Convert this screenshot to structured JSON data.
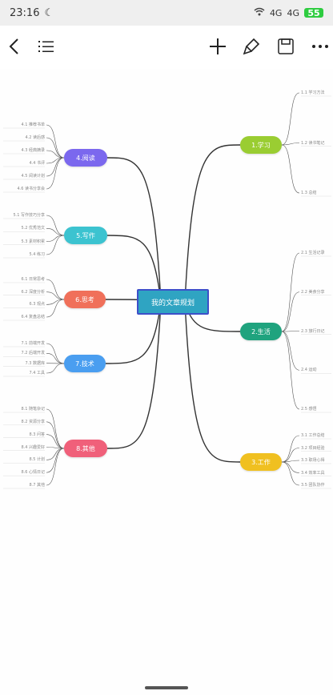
{
  "status_bar": {
    "time": "23:16",
    "signal_1": "4G",
    "signal_2": "4G",
    "battery": "55"
  },
  "toolbar": {
    "back_icon": "chevron-left-icon",
    "outline_icon": "list-icon",
    "add_icon": "plus-icon",
    "style_icon": "brush-icon",
    "save_icon": "save-icon",
    "more_icon": "more-icon"
  },
  "mindmap": {
    "central": {
      "label": "我的文章规划",
      "color": "#2fa4c2",
      "border": "#3d4fc9"
    },
    "branches": [
      {
        "id": "b1",
        "label": "1.学习",
        "color": "#9acd32",
        "leaves": [
          "1.1 学习方法",
          "1.2 读书笔记",
          "1.3 总结"
        ]
      },
      {
        "id": "b2",
        "label": "2.生活",
        "color": "#1fa37e",
        "leaves": [
          "2.1 生活记录",
          "2.2 美食分享",
          "2.3 旅行日记",
          "2.4 运动",
          "2.5 感悟"
        ]
      },
      {
        "id": "b3",
        "label": "3.工作",
        "color": "#f0c020",
        "leaves": [
          "3.1 工作总结",
          "3.2 项目经验",
          "3.3 职场心得",
          "3.4 效率工具",
          "3.5 团队协作"
        ]
      },
      {
        "id": "b4",
        "label": "4.阅读",
        "color": "#7b68ee",
        "leaves": [
          "4.1 推荐书单",
          "4.2 读后感",
          "4.3 经典摘录",
          "4.4 书评",
          "4.5 阅读计划",
          "4.6 读书分享会"
        ]
      },
      {
        "id": "b5",
        "label": "5.写作",
        "color": "#3cc3d0",
        "leaves": [
          "5.1 写作技巧分享",
          "5.2 优秀范文",
          "5.3 素材积累",
          "5.4 练习"
        ]
      },
      {
        "id": "b6",
        "label": "6.思考",
        "color": "#f0705a",
        "leaves": [
          "6.1 日常思考",
          "6.2 深度分析",
          "6.3 观点",
          "6.4 复盘总结"
        ]
      },
      {
        "id": "b7",
        "label": "7.技术",
        "color": "#4a9ef0",
        "leaves": [
          "7.1 前端开发",
          "7.2 后端开发",
          "7.3 数据库",
          "7.4 工具"
        ]
      },
      {
        "id": "b8",
        "label": "8.其他",
        "color": "#f0607a",
        "leaves": [
          "8.1 随笔杂记",
          "8.2 资源分享",
          "8.3 问答",
          "8.4 兴趣爱好",
          "8.5 计划",
          "8.6 心情日记",
          "8.7 其他"
        ]
      }
    ]
  }
}
